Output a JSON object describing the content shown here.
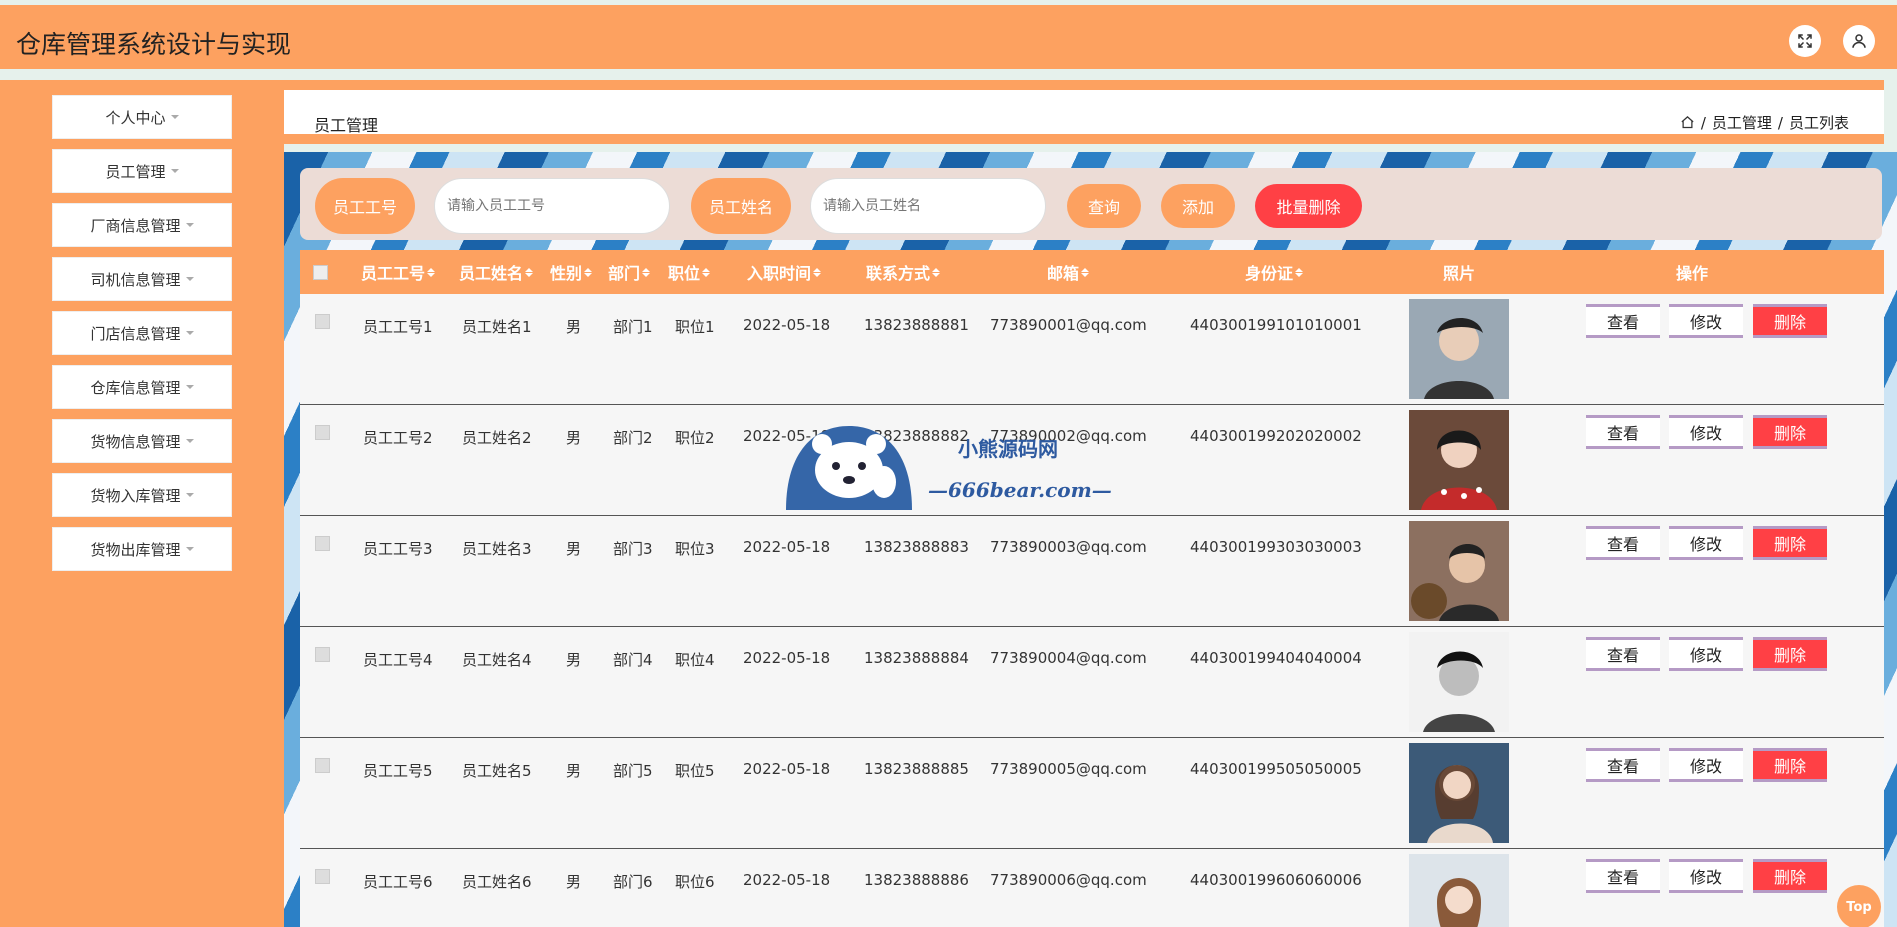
{
  "header": {
    "title": "仓库管理系统设计与实现",
    "fullscreen_icon": "fullscreen-icon",
    "user_icon": "user-icon"
  },
  "sidebar": {
    "items": [
      {
        "label": "个人中心"
      },
      {
        "label": "员工管理"
      },
      {
        "label": "厂商信息管理"
      },
      {
        "label": "司机信息管理"
      },
      {
        "label": "门店信息管理"
      },
      {
        "label": "仓库信息管理"
      },
      {
        "label": "货物信息管理"
      },
      {
        "label": "货物入库管理"
      },
      {
        "label": "货物出库管理"
      }
    ]
  },
  "page": {
    "title": "员工管理",
    "breadcrumb": [
      "员工管理",
      "员工列表"
    ],
    "breadcrumb_sep": "/"
  },
  "search": {
    "field1_label": "员工工号",
    "field1_placeholder": "请输入员工工号",
    "field2_label": "员工姓名",
    "field2_placeholder": "请输入员工姓名",
    "query_label": "查询",
    "add_label": "添加",
    "batch_delete_label": "批量删除"
  },
  "table": {
    "headers": [
      "员工工号",
      "员工姓名",
      "性别",
      "部门",
      "职位",
      "入职时间",
      "联系方式",
      "邮箱",
      "身份证",
      "照片",
      "操作"
    ],
    "rows": [
      {
        "id": "员工工号1",
        "name": "员工姓名1",
        "gender": "男",
        "dept": "部门1",
        "position": "职位1",
        "date": "2022-05-18",
        "phone": "13823888881",
        "email": "773890001@qq.com",
        "idcard": "440300199101010001"
      },
      {
        "id": "员工工号2",
        "name": "员工姓名2",
        "gender": "男",
        "dept": "部门2",
        "position": "职位2",
        "date": "2022-05-18",
        "phone": "13823888882",
        "email": "773890002@qq.com",
        "idcard": "440300199202020002"
      },
      {
        "id": "员工工号3",
        "name": "员工姓名3",
        "gender": "男",
        "dept": "部门3",
        "position": "职位3",
        "date": "2022-05-18",
        "phone": "13823888883",
        "email": "773890003@qq.com",
        "idcard": "440300199303030003"
      },
      {
        "id": "员工工号4",
        "name": "员工姓名4",
        "gender": "男",
        "dept": "部门4",
        "position": "职位4",
        "date": "2022-05-18",
        "phone": "13823888884",
        "email": "773890004@qq.com",
        "idcard": "440300199404040004"
      },
      {
        "id": "员工工号5",
        "name": "员工姓名5",
        "gender": "男",
        "dept": "部门5",
        "position": "职位5",
        "date": "2022-05-18",
        "phone": "13823888885",
        "email": "773890005@qq.com",
        "idcard": "440300199505050005"
      },
      {
        "id": "员工工号6",
        "name": "员工姓名6",
        "gender": "男",
        "dept": "部门6",
        "position": "职位6",
        "date": "2022-05-18",
        "phone": "13823888886",
        "email": "773890006@qq.com",
        "idcard": "440300199606060006"
      }
    ],
    "actions": {
      "view": "查看",
      "edit": "修改",
      "delete": "删除"
    }
  },
  "watermark": {
    "line1": "小熊源码网",
    "line2": "—666bear.com—"
  },
  "top_button": "Top",
  "colors": {
    "accent": "#fda160",
    "danger": "#ff4045",
    "action_border": "#b59ac5"
  }
}
